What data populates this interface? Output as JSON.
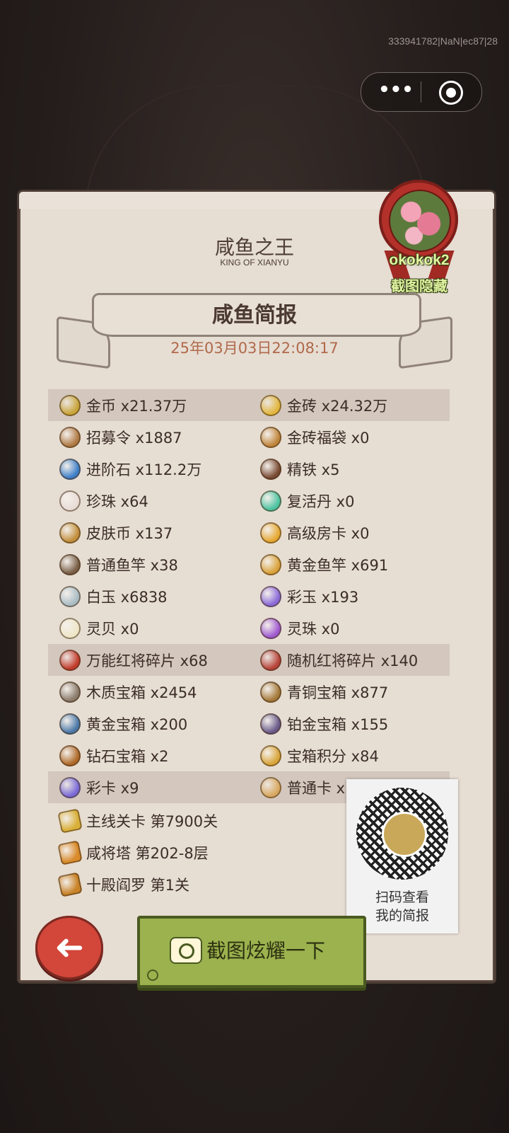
{
  "build_id": "333941782|NaN|ec87|28",
  "header": {
    "title_cn": "咸鱼之王",
    "title_en": "KING OF XIANYU"
  },
  "report": {
    "title": "咸鱼简报",
    "timestamp": "25年03月03日22:08:17"
  },
  "player": {
    "name": "okokok2",
    "hide_hint": "截图隐藏"
  },
  "items": [
    {
      "highlight": true,
      "left": {
        "label": "金币 x21.37万",
        "icon": "gold-coin-icon",
        "color": "#c9a43a"
      },
      "right": {
        "label": "金砖 x24.32万",
        "icon": "gold-brick-icon",
        "color": "#e2b63d"
      }
    },
    {
      "highlight": false,
      "left": {
        "label": "招募令 x1887",
        "icon": "recruit-token-icon",
        "color": "#b07a45"
      },
      "right": {
        "label": "金砖福袋 x0",
        "icon": "lucky-bag-icon",
        "color": "#c0853b"
      }
    },
    {
      "highlight": false,
      "left": {
        "label": "进阶石 x112.2万",
        "icon": "advance-stone-icon",
        "color": "#3e7fc8"
      },
      "right": {
        "label": "精铁 x5",
        "icon": "fine-iron-icon",
        "color": "#7a4b34"
      }
    },
    {
      "highlight": false,
      "left": {
        "label": "珍珠 x64",
        "icon": "pearl-icon",
        "color": "#e9dcd6"
      },
      "right": {
        "label": "复活丹 x0",
        "icon": "revive-pill-icon",
        "color": "#4cc3a0"
      }
    },
    {
      "highlight": false,
      "left": {
        "label": "皮肤币 x137",
        "icon": "skin-coin-icon",
        "color": "#c28f3d"
      },
      "right": {
        "label": "高级房卡 x0",
        "icon": "room-card-icon",
        "color": "#e6a832"
      }
    },
    {
      "highlight": false,
      "left": {
        "label": "普通鱼竿 x38",
        "icon": "normal-rod-icon",
        "color": "#7a6048"
      },
      "right": {
        "label": "黄金鱼竿 x691",
        "icon": "golden-rod-icon",
        "color": "#d9a23a"
      }
    },
    {
      "highlight": false,
      "left": {
        "label": "白玉 x6838",
        "icon": "white-jade-icon",
        "color": "#a9bcc4"
      },
      "right": {
        "label": "彩玉 x193",
        "icon": "colored-jade-icon",
        "color": "#8a6ad8"
      }
    },
    {
      "highlight": false,
      "left": {
        "label": "灵贝 x0",
        "icon": "spirit-shell-icon",
        "color": "#efe6c8"
      },
      "right": {
        "label": "灵珠 x0",
        "icon": "spirit-orb-icon",
        "color": "#a05ad0"
      }
    },
    {
      "highlight": true,
      "left": {
        "label": "万能红将碎片 x68",
        "icon": "universal-shard-icon",
        "color": "#c23c2c"
      },
      "right": {
        "label": "随机红将碎片 x140",
        "icon": "random-shard-icon",
        "color": "#b8443a"
      }
    },
    {
      "highlight": false,
      "left": {
        "label": "木质宝箱 x2454",
        "icon": "wooden-chest-icon",
        "color": "#8a7a6a"
      },
      "right": {
        "label": "青铜宝箱 x877",
        "icon": "bronze-chest-icon",
        "color": "#a57a3a"
      }
    },
    {
      "highlight": false,
      "left": {
        "label": "黄金宝箱 x200",
        "icon": "gold-chest-icon",
        "color": "#4b78a8"
      },
      "right": {
        "label": "铂金宝箱 x155",
        "icon": "platinum-chest-icon",
        "color": "#6a5a8a"
      }
    },
    {
      "highlight": false,
      "left": {
        "label": "钻石宝箱 x2",
        "icon": "diamond-chest-icon",
        "color": "#b06a2a"
      },
      "right": {
        "label": "宝箱积分 x84",
        "icon": "chest-points-icon",
        "color": "#d9a53a"
      }
    },
    {
      "highlight": true,
      "left": {
        "label": "彩卡 x9",
        "icon": "color-card-icon",
        "color": "#7a6ad8"
      },
      "right": {
        "label": "普通卡 x",
        "icon": "normal-card-icon",
        "color": "#d9a860"
      }
    }
  ],
  "progress": [
    {
      "label": "主线关卡 第7900关",
      "icon": "main-stage-icon",
      "color": "#d9b03a"
    },
    {
      "label": "咸将塔 第202-8层",
      "icon": "tower-icon",
      "color": "#d98a2a"
    },
    {
      "label": "十殿阎罗 第1关",
      "icon": "yama-icon",
      "color": "#c9842a"
    }
  ],
  "qr_card": {
    "line1": "扫码查看",
    "line2": "我的简报"
  },
  "buttons": {
    "back_arrow": "➜",
    "share_label": "截图炫耀一下"
  },
  "capsule": {
    "more": "•••"
  }
}
